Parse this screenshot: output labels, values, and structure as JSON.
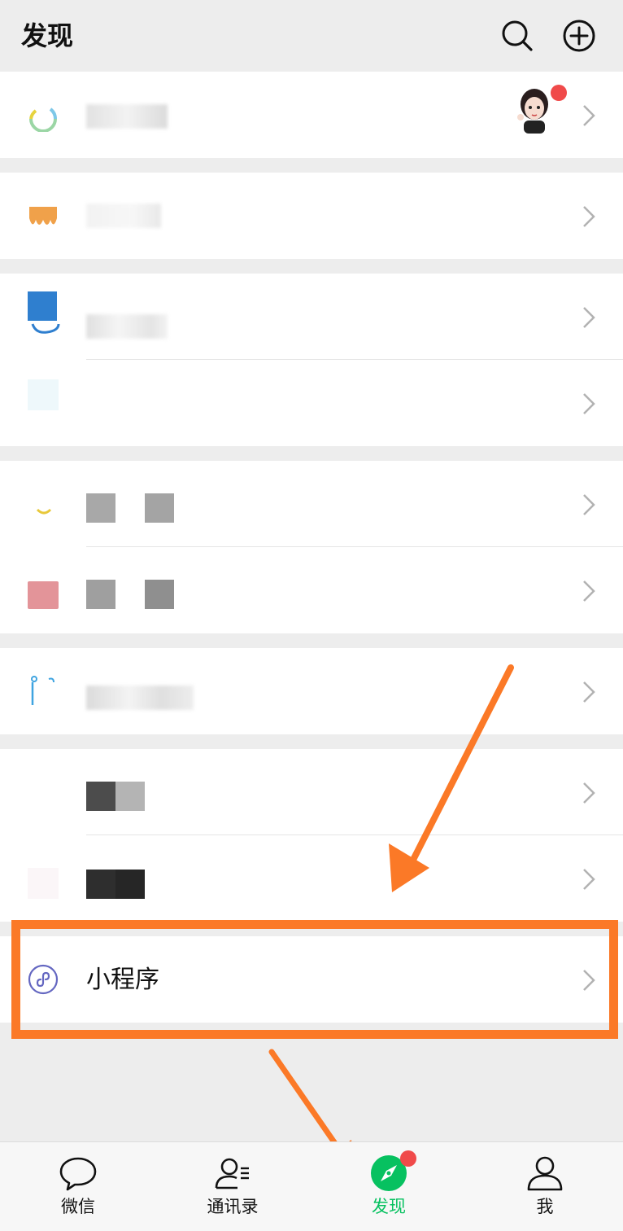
{
  "header": {
    "title": "发现",
    "search_icon": "search-icon",
    "add_icon": "plus-circle-icon"
  },
  "menu": {
    "mini_program_label": "小程序"
  },
  "tabbar": {
    "tabs": [
      {
        "label": "微信",
        "icon": "chat-bubble-icon"
      },
      {
        "label": "通讯录",
        "icon": "contacts-icon"
      },
      {
        "label": "发现",
        "icon": "compass-icon",
        "active": true
      },
      {
        "label": "我",
        "icon": "person-icon"
      }
    ]
  },
  "colors": {
    "accent": "#07c160",
    "annotation": "#fb7927",
    "badge": "#f04a4a",
    "mini_program_icon": "#6467c1"
  }
}
